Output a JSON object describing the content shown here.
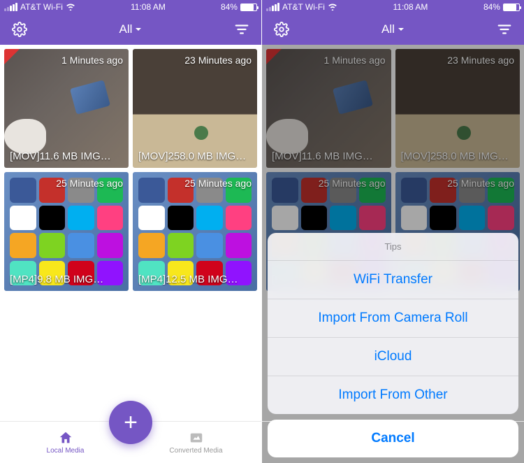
{
  "status": {
    "carrier": "AT&T Wi-Fi",
    "time": "11:08 AM",
    "battery": "84%"
  },
  "header": {
    "title": "All"
  },
  "media": [
    {
      "time": "1 Minutes ago",
      "name": "[MOV]11.6 MB IMG…"
    },
    {
      "time": "23 Minutes ago",
      "name": "[MOV]258.0 MB IMG…"
    },
    {
      "time": "25 Minutes ago",
      "name": "[MP4]9.8 MB IMG…"
    },
    {
      "time": "25 Minutes ago",
      "name": "[MP4]12.5 MB IMG…"
    }
  ],
  "tabs": {
    "local": "Local Media",
    "converted": "Converted Media"
  },
  "sheet": {
    "title": "Tips",
    "items": [
      "WiFi Transfer",
      "Import From Camera Roll",
      "iCloud",
      "Import From Other"
    ],
    "cancel": "Cancel"
  }
}
